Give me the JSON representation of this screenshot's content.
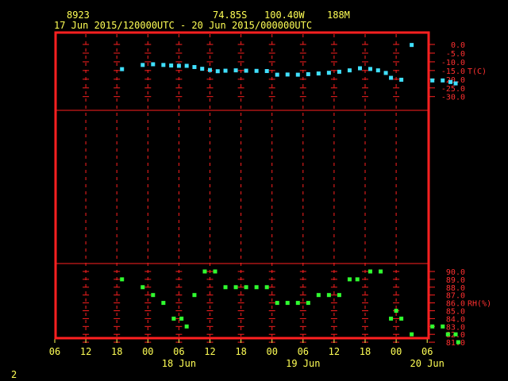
{
  "header": {
    "station": "8923",
    "lat": "74.85S",
    "lon": "100.40W",
    "elev": "188M",
    "period": "17 Jun 2015/120000UTC - 20 Jun 2015/000000UTC"
  },
  "footer": {
    "page": "2"
  },
  "colors": {
    "frame": "#ff2020",
    "grid": "#ff2020",
    "text": "#ffff55",
    "temp": "#40e0ff",
    "rh": "#30ff30",
    "background": "#000000"
  },
  "chart_data": [
    {
      "type": "scatter",
      "ylabel": "T(C)",
      "ylim": [
        -30,
        0
      ],
      "yticks": [
        "0.0",
        "-5.0",
        "-10.0",
        "-15.0",
        "-20.0",
        "-25.0",
        "-30.0"
      ],
      "xlim": [
        0,
        72
      ],
      "x_tick_labels": [
        "06",
        "12",
        "18",
        "00",
        "06",
        "12",
        "18",
        "00",
        "06",
        "12",
        "18",
        "00",
        "06"
      ],
      "x_date_labels": [
        {
          "label": "18 Jun",
          "hour": 24
        },
        {
          "label": "19 Jun",
          "hour": 48
        },
        {
          "label": "20 Jun",
          "hour": 72
        }
      ],
      "series": [
        {
          "points": [
            [
              13,
              -14.2
            ],
            [
              17,
              -11.8
            ],
            [
              19,
              -11.4
            ],
            [
              21,
              -11.8
            ],
            [
              22.5,
              -12.1
            ],
            [
              24,
              -12.3
            ],
            [
              25.5,
              -12.3
            ],
            [
              27,
              -13
            ],
            [
              28.5,
              -14
            ],
            [
              30,
              -14.7
            ],
            [
              31.5,
              -15.4
            ],
            [
              33,
              -15.1
            ],
            [
              35,
              -14.9
            ],
            [
              37,
              -15.1
            ],
            [
              39,
              -15.2
            ],
            [
              41,
              -15.3
            ],
            [
              43,
              -17.4
            ],
            [
              45,
              -17.3
            ],
            [
              47,
              -17.4
            ],
            [
              49,
              -17.1
            ],
            [
              51,
              -16.7
            ],
            [
              53,
              -16.3
            ],
            [
              55,
              -15.7
            ],
            [
              57,
              -14.9
            ],
            [
              59,
              -13.7
            ],
            [
              61,
              -14.1
            ],
            [
              62.5,
              -14.9
            ],
            [
              64,
              -16.4
            ],
            [
              65,
              -19.2
            ],
            [
              67,
              -20.3
            ],
            [
              69,
              -0.3
            ],
            [
              73,
              -20.7
            ],
            [
              75,
              -20.7
            ],
            [
              76.5,
              -21.6
            ],
            [
              77.5,
              -22.4
            ]
          ]
        }
      ]
    },
    {
      "type": "scatter",
      "ylabel": "RH(%)",
      "ylim": [
        81,
        90
      ],
      "yticks": [
        "90.0",
        "89.0",
        "88.0",
        "87.0",
        "86.0",
        "85.0",
        "84.0",
        "83.0",
        "82.0",
        "81.0"
      ],
      "series": [
        {
          "points": [
            [
              13,
              89
            ],
            [
              17,
              88
            ],
            [
              19,
              87
            ],
            [
              21,
              86
            ],
            [
              23,
              84
            ],
            [
              24.5,
              84
            ],
            [
              25.5,
              83
            ],
            [
              27,
              87
            ],
            [
              29,
              90
            ],
            [
              31,
              90
            ],
            [
              33,
              88
            ],
            [
              35,
              88
            ],
            [
              37,
              88
            ],
            [
              39,
              88
            ],
            [
              41,
              88
            ],
            [
              43,
              86
            ],
            [
              45,
              86
            ],
            [
              47,
              86
            ],
            [
              49,
              86
            ],
            [
              51,
              87
            ],
            [
              53,
              87
            ],
            [
              55,
              87
            ],
            [
              57,
              89
            ],
            [
              58.5,
              89
            ],
            [
              61,
              90
            ],
            [
              63,
              90
            ],
            [
              65,
              84
            ],
            [
              66,
              85
            ],
            [
              67,
              84
            ],
            [
              69,
              82
            ],
            [
              73,
              83
            ],
            [
              75,
              83
            ],
            [
              76,
              82
            ],
            [
              77.5,
              82
            ],
            [
              78,
              81
            ]
          ]
        }
      ]
    }
  ]
}
